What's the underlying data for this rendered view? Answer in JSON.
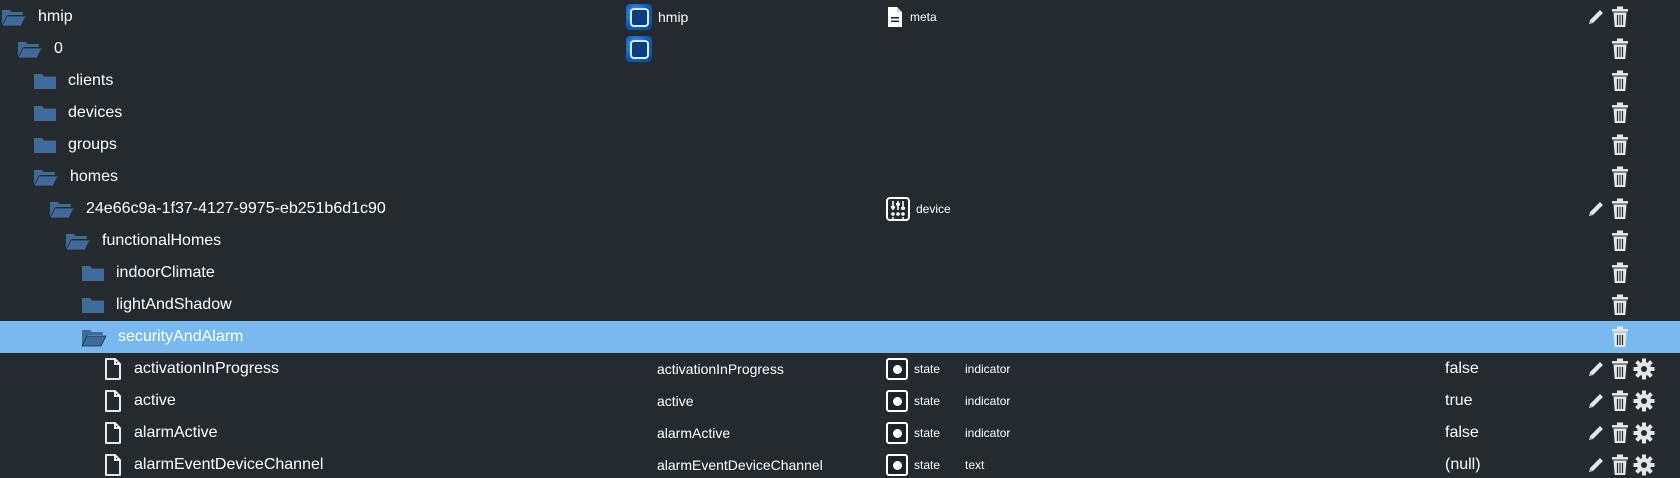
{
  "colors": {
    "background": "#242a2e",
    "selected_row": "#78b9f0",
    "folder": "#3e6b9a",
    "text": "#ffffff"
  },
  "icons": {
    "folder_open": "folder-open-icon",
    "folder_closed": "folder-icon",
    "file": "file-icon",
    "adapter": "adapter-icon",
    "meta": "meta-icon",
    "device": "device-icon",
    "state": "state-icon",
    "edit": "pencil-icon",
    "delete": "trash-icon",
    "settings": "gear-icon"
  },
  "rows": [
    {
      "id": "hmip",
      "name": "hmip",
      "icon": "folder-open",
      "adapter_icon": true,
      "object_name": "hmip",
      "type_icon": "meta",
      "type": "meta",
      "role": "",
      "value": "",
      "edit": true,
      "delete": true,
      "settings": false
    },
    {
      "id": "0",
      "name": "0",
      "icon": "folder-open",
      "adapter_icon": true,
      "object_name": "",
      "type_icon": "",
      "type": "",
      "role": "",
      "value": "",
      "edit": false,
      "delete": true,
      "settings": false
    },
    {
      "id": "clients",
      "name": "clients",
      "icon": "folder",
      "adapter_icon": false,
      "object_name": "",
      "type_icon": "",
      "type": "",
      "role": "",
      "value": "",
      "edit": false,
      "delete": true,
      "settings": false
    },
    {
      "id": "devices",
      "name": "devices",
      "icon": "folder",
      "adapter_icon": false,
      "object_name": "",
      "type_icon": "",
      "type": "",
      "role": "",
      "value": "",
      "edit": false,
      "delete": true,
      "settings": false
    },
    {
      "id": "groups",
      "name": "groups",
      "icon": "folder",
      "adapter_icon": false,
      "object_name": "",
      "type_icon": "",
      "type": "",
      "role": "",
      "value": "",
      "edit": false,
      "delete": true,
      "settings": false
    },
    {
      "id": "homes",
      "name": "homes",
      "icon": "folder-open",
      "adapter_icon": false,
      "object_name": "",
      "type_icon": "",
      "type": "",
      "role": "",
      "value": "",
      "edit": false,
      "delete": true,
      "settings": false
    },
    {
      "id": "home-id",
      "name": "24e66c9a-1f37-4127-9975-eb251b6d1c90",
      "icon": "folder-open",
      "adapter_icon": false,
      "object_name": "",
      "type_icon": "device",
      "type": "device",
      "role": "",
      "value": "",
      "edit": true,
      "delete": true,
      "settings": false
    },
    {
      "id": "functionalHomes",
      "name": "functionalHomes",
      "icon": "folder-open",
      "adapter_icon": false,
      "object_name": "",
      "type_icon": "",
      "type": "",
      "role": "",
      "value": "",
      "edit": false,
      "delete": true,
      "settings": false
    },
    {
      "id": "indoorClimate",
      "name": "indoorClimate",
      "icon": "folder",
      "adapter_icon": false,
      "object_name": "",
      "type_icon": "",
      "type": "",
      "role": "",
      "value": "",
      "edit": false,
      "delete": true,
      "settings": false
    },
    {
      "id": "lightAndShadow",
      "name": "lightAndShadow",
      "icon": "folder",
      "adapter_icon": false,
      "object_name": "",
      "type_icon": "",
      "type": "",
      "role": "",
      "value": "",
      "edit": false,
      "delete": true,
      "settings": false
    },
    {
      "id": "securityAndAlarm",
      "name": "securityAndAlarm",
      "icon": "folder-open",
      "adapter_icon": false,
      "object_name": "",
      "type_icon": "",
      "type": "",
      "role": "",
      "value": "",
      "edit": false,
      "delete": true,
      "settings": false,
      "selected": true
    },
    {
      "id": "activationInProgress",
      "name": "activationInProgress",
      "icon": "file",
      "adapter_icon": false,
      "object_name": "activationInProgress",
      "type_icon": "state",
      "type": "state",
      "role": "indicator",
      "value": "false",
      "edit": true,
      "delete": true,
      "settings": true
    },
    {
      "id": "active",
      "name": "active",
      "icon": "file",
      "adapter_icon": false,
      "object_name": "active",
      "type_icon": "state",
      "type": "state",
      "role": "indicator",
      "value": "true",
      "edit": true,
      "delete": true,
      "settings": true
    },
    {
      "id": "alarmActive",
      "name": "alarmActive",
      "icon": "file",
      "adapter_icon": false,
      "object_name": "alarmActive",
      "type_icon": "state",
      "type": "state",
      "role": "indicator",
      "value": "false",
      "edit": true,
      "delete": true,
      "settings": true
    },
    {
      "id": "alarmEventDeviceChannel",
      "name": "alarmEventDeviceChannel",
      "icon": "file",
      "adapter_icon": false,
      "object_name": "alarmEventDeviceChannel",
      "type_icon": "state",
      "type": "state",
      "role": "text",
      "value": "(null)",
      "edit": true,
      "delete": true,
      "settings": true
    }
  ]
}
